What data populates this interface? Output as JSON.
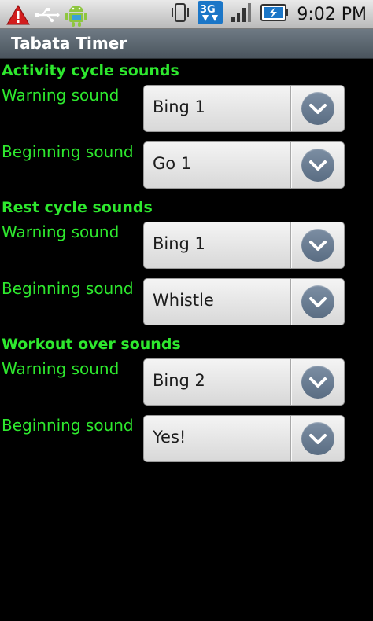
{
  "status_bar": {
    "time": "9:02 PM",
    "icons": [
      "warning-icon",
      "usb-icon",
      "android-icon",
      "vibrate-icon",
      "3g-icon",
      "signal-icon",
      "battery-charging-icon"
    ],
    "network_label": "3G"
  },
  "title_bar": {
    "title": "Tabata Timer"
  },
  "sections": [
    {
      "header": "Activity cycle sounds",
      "rows": [
        {
          "label": "Warning sound",
          "value": "Bing 1"
        },
        {
          "label": "Beginning sound",
          "value": "Go 1"
        }
      ]
    },
    {
      "header": "Rest cycle sounds",
      "rows": [
        {
          "label": "Warning sound",
          "value": "Bing 1"
        },
        {
          "label": "Beginning sound",
          "value": "Whistle"
        }
      ]
    },
    {
      "header": "Workout over sounds",
      "rows": [
        {
          "label": "Warning sound",
          "value": "Bing 2"
        },
        {
          "label": "Beginning sound",
          "value": "Yes!"
        }
      ]
    }
  ],
  "colors": {
    "label_green": "#2ee82e",
    "background": "#000000",
    "title_bar": "#59636c"
  }
}
